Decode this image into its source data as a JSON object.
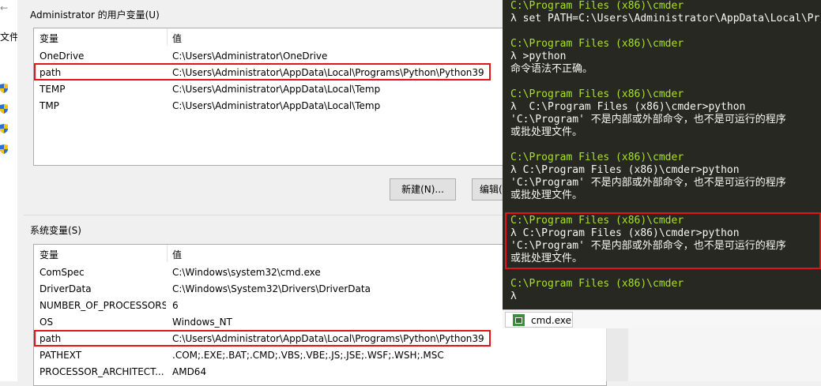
{
  "left_strip": {
    "label": "文件"
  },
  "user_vars": {
    "title": "Administrator 的用户变量(U)",
    "header": {
      "name": "变量",
      "value": "值"
    },
    "rows": [
      {
        "name": "OneDrive",
        "value": "C:\\Users\\Administrator\\OneDrive"
      },
      {
        "name": "path",
        "value": "C:\\Users\\Administrator\\AppData\\Local\\Programs\\Python\\Python39"
      },
      {
        "name": "TEMP",
        "value": "C:\\Users\\Administrator\\AppData\\Local\\Temp"
      },
      {
        "name": "TMP",
        "value": "C:\\Users\\Administrator\\AppData\\Local\\Temp"
      }
    ],
    "buttons": {
      "new": "新建(N)...",
      "edit": "编辑("
    }
  },
  "system_vars": {
    "title": "系统变量(S)",
    "header": {
      "name": "变量",
      "value": "值"
    },
    "rows": [
      {
        "name": "ComSpec",
        "value": "C:\\Windows\\system32\\cmd.exe"
      },
      {
        "name": "DriverData",
        "value": "C:\\Windows\\System32\\Drivers\\DriverData"
      },
      {
        "name": "NUMBER_OF_PROCESSORS",
        "value": "6"
      },
      {
        "name": "OS",
        "value": "Windows_NT"
      },
      {
        "name": "path",
        "value": "C:\\Users\\Administrator\\AppData\\Local\\Programs\\Python\\Python39"
      },
      {
        "name": "PATHEXT",
        "value": ".COM;.EXE;.BAT;.CMD;.VBS;.VBE;.JS;.JSE;.WSF;.WSH;.MSC"
      },
      {
        "name": "PROCESSOR_ARCHITECT...",
        "value": "AMD64"
      }
    ]
  },
  "terminal": {
    "lines": [
      {
        "text": "C:\\Program Files (x86)\\cmder",
        "kind": "path"
      },
      {
        "text": "λ set PATH=C:\\Users\\Administrator\\AppData\\Local\\Pr",
        "kind": "cmd"
      },
      {
        "text": "",
        "kind": "blank"
      },
      {
        "text": "C:\\Program Files (x86)\\cmder",
        "kind": "path"
      },
      {
        "text": "λ >python",
        "kind": "cmd"
      },
      {
        "text": "命令语法不正确。",
        "kind": "out"
      },
      {
        "text": "",
        "kind": "blank"
      },
      {
        "text": "C:\\Program Files (x86)\\cmder",
        "kind": "path"
      },
      {
        "text": "λ  C:\\Program Files (x86)\\cmder>python",
        "kind": "cmd"
      },
      {
        "text": "'C:\\Program' 不是内部或外部命令，也不是可运行的程序",
        "kind": "out"
      },
      {
        "text": "或批处理文件。",
        "kind": "out"
      },
      {
        "text": "",
        "kind": "blank"
      },
      {
        "text": "C:\\Program Files (x86)\\cmder",
        "kind": "path"
      },
      {
        "text": "λ C:\\Program Files (x86)\\cmder>python",
        "kind": "cmd"
      },
      {
        "text": "'C:\\Program' 不是内部或外部命令，也不是可运行的程序",
        "kind": "out"
      },
      {
        "text": "或批处理文件。",
        "kind": "out"
      },
      {
        "text": "",
        "kind": "blank"
      },
      {
        "text": "C:\\Program Files (x86)\\cmder",
        "kind": "path"
      },
      {
        "text": "λ C:\\Program Files (x86)\\cmder>python",
        "kind": "cmd"
      },
      {
        "text": "'C:\\Program' 不是内部或外部命令，也不是可运行的程序",
        "kind": "out"
      },
      {
        "text": "或批处理文件。",
        "kind": "out"
      },
      {
        "text": "",
        "kind": "blank"
      },
      {
        "text": "C:\\Program Files (x86)\\cmder",
        "kind": "path"
      },
      {
        "text": "λ",
        "kind": "cmd"
      }
    ],
    "colors": {
      "background": "#272822",
      "path": "#a6e22e",
      "text": "#f8f8f2"
    },
    "tab_label": "cmd.exe"
  },
  "highlight_color": "#e3131b"
}
